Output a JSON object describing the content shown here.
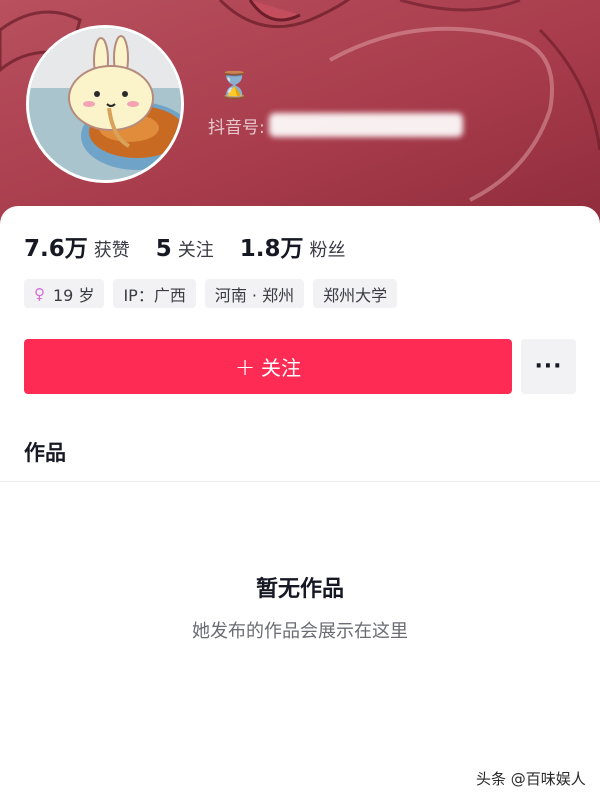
{
  "profile": {
    "douyin_id_label": "抖音号:",
    "hourglass_icon": "hourglass-icon"
  },
  "stats": [
    {
      "value": "7.6万",
      "label": "获赞"
    },
    {
      "value": "5",
      "label": "关注"
    },
    {
      "value": "1.8万",
      "label": "粉丝"
    }
  ],
  "tags": {
    "gender_icon": "female-icon",
    "age": "19 岁",
    "ip": "IP：广西",
    "location": "河南 · 郑州",
    "school": "郑州大学"
  },
  "actions": {
    "follow_plus": "+",
    "follow_label": "关注",
    "more_label": "···"
  },
  "works": {
    "tab_title": "作品",
    "empty_title": "暂无作品",
    "empty_subtitle": "她发布的作品会展示在这里"
  },
  "watermark": "头条 @百味娱人",
  "colors": {
    "header": "#a83c4c",
    "follow_button": "#fe2c55",
    "tag_background": "#f2f2f4"
  }
}
